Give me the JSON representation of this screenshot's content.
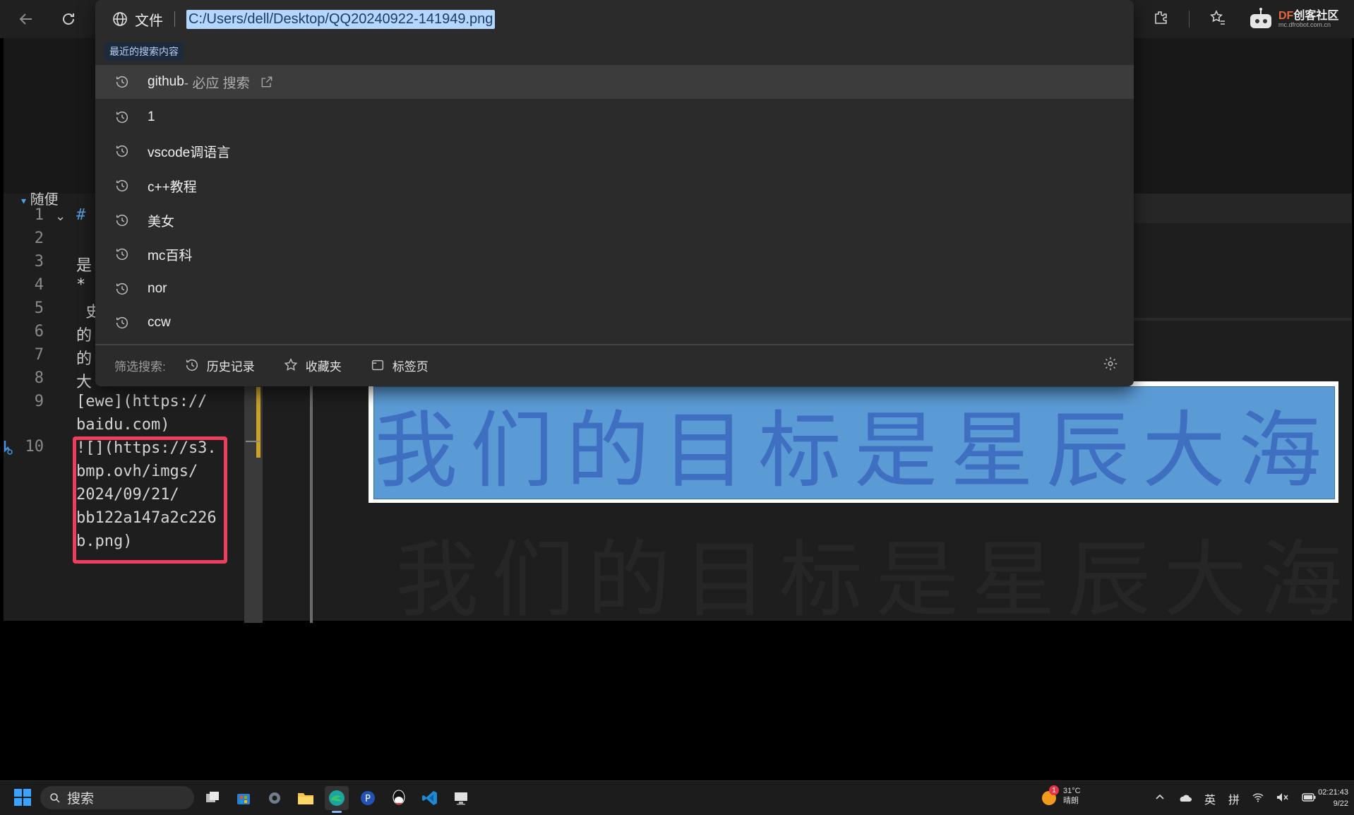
{
  "omnibox": {
    "scheme_label": "文件",
    "url": "C:/Users/dell/Desktop/QQ20240922-141949.png",
    "recent_label": "最近的搜索内容",
    "suggestions": [
      {
        "text": "github",
        "suffix": " - 必应 搜索",
        "active": true
      },
      {
        "text": "1"
      },
      {
        "text": "vscode调语言"
      },
      {
        "text": "c++教程"
      },
      {
        "text": "美女"
      },
      {
        "text": "mc百科"
      },
      {
        "text": "nor"
      },
      {
        "text": "ccw"
      }
    ],
    "filter_label": "筛选搜索:",
    "filters": [
      "历史记录",
      "收藏夹",
      "标签页"
    ]
  },
  "brand": {
    "name": "创客社区",
    "prefix": "DF",
    "domain": "mc.dfrobot.com.cn"
  },
  "editor": {
    "section_heading": "随便",
    "line_numbers": [
      "1",
      "2",
      "3",
      "4",
      "5",
      "6",
      "7",
      "8",
      "9",
      "10"
    ],
    "lines": {
      "l1": "#",
      "l3": "是",
      "l4": "*",
      "l5": " 史",
      "l6": "的",
      "l7": "的",
      "l8": "大",
      "l9a": "[ewe](https://",
      "l9b": "baidu.com)",
      "l10": [
        "![](https://s3.",
        "bmp.ovh/imgs/",
        "2024/09/21/",
        "bb122a147a2c226",
        "b.png)"
      ]
    }
  },
  "preview": {
    "banner_text": "我们的目标是星辰大海"
  },
  "taskbar": {
    "search_placeholder": "搜索",
    "weather_temp": "31°C",
    "weather_desc": "晴朗",
    "weather_badge": "1",
    "ime_lang": "英",
    "ime_mode": "拼",
    "time": "02:21:43",
    "date": "9/22"
  },
  "colors": {
    "accent_red": "#ee3e5d",
    "banner_blue": "#5b9bd5",
    "selection": "#b3d7ff"
  }
}
